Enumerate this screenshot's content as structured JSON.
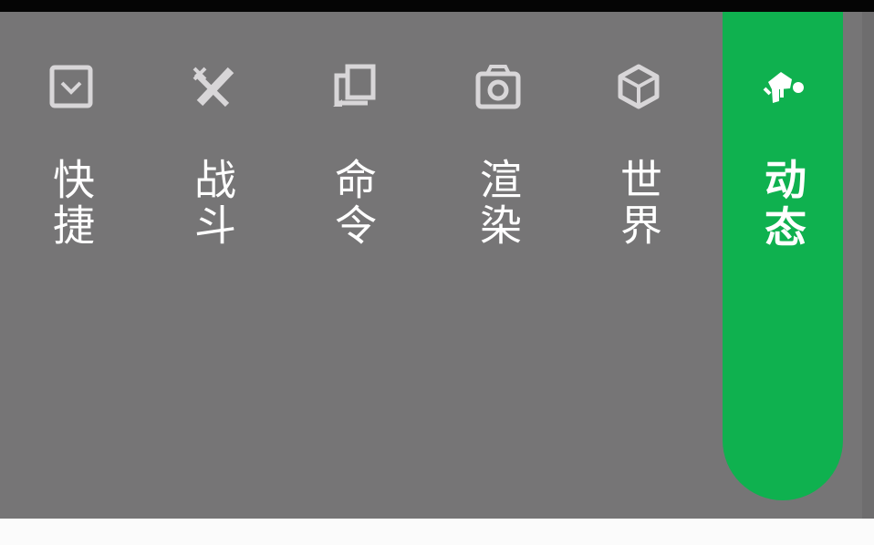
{
  "tabs": [
    {
      "id": "quick",
      "label": "快捷",
      "icon": "checkbox-icon"
    },
    {
      "id": "combat",
      "label": "战斗",
      "icon": "crossed-swords-icon"
    },
    {
      "id": "command",
      "label": "命令",
      "icon": "command-block-icon"
    },
    {
      "id": "render",
      "label": "渲染",
      "icon": "camera-icon"
    },
    {
      "id": "world",
      "label": "世界",
      "icon": "cube-icon"
    },
    {
      "id": "movement",
      "label": "动态",
      "icon": "running-person-icon",
      "active": true
    }
  ],
  "colors": {
    "accent": "#0fb14f",
    "background": "#767576",
    "icon": "#d8d6d8",
    "label": "#ffffff"
  }
}
